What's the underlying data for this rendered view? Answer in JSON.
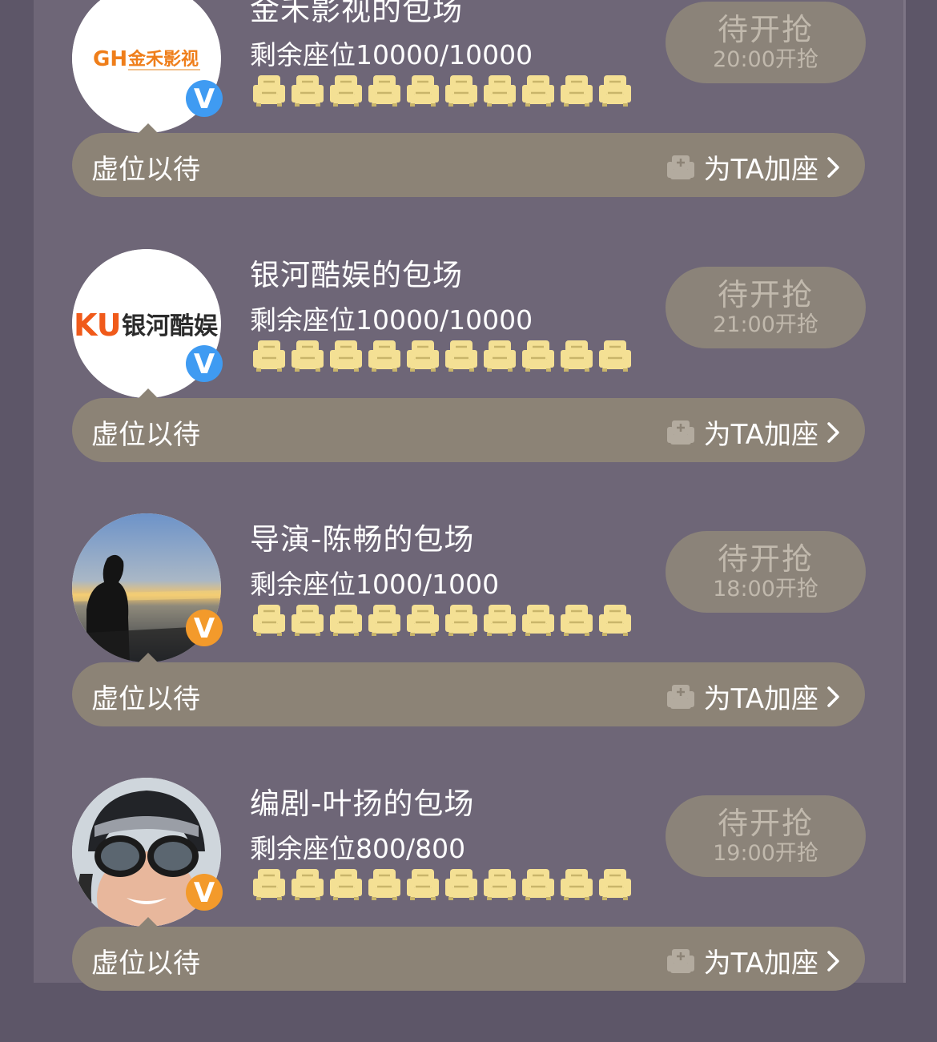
{
  "colors": {
    "background": "#5d5668",
    "panel": "#6e6677",
    "pill": "#8b8379",
    "bar": "#8c8376",
    "seat_gold": "#f4e094",
    "verify_blue": "#3f9bf2",
    "verify_orange": "#f39a2b"
  },
  "cards": [
    {
      "avatar_logo_text": "金禾影视",
      "badge": "V",
      "title": "金禾影视的包场",
      "seats_text": "剩余座位10000/10000",
      "button_main": "待开抢",
      "button_time": "20:00开抢",
      "bar_left": "虚位以待",
      "bar_action": "为TA加座"
    },
    {
      "avatar_logo_text": "银河酷娱",
      "badge": "V",
      "title": "银河酷娱的包场",
      "seats_text": "剩余座位10000/10000",
      "button_main": "待开抢",
      "button_time": "21:00开抢",
      "bar_left": "虚位以待",
      "bar_action": "为TA加座"
    },
    {
      "badge": "V",
      "title": "导演-陈畅的包场",
      "seats_text": "剩余座位1000/1000",
      "button_main": "待开抢",
      "button_time": "18:00开抢",
      "bar_left": "虚位以待",
      "bar_action": "为TA加座"
    },
    {
      "badge": "V",
      "title": "编剧-叶扬的包场",
      "seats_text": "剩余座位800/800",
      "button_main": "待开抢",
      "button_time": "19:00开抢",
      "bar_left": "虚位以待",
      "bar_action": "为TA加座"
    }
  ],
  "icons": {
    "seat": "armchair-icon",
    "add_seat": "add-seat-icon",
    "chevron": "chevron-right-icon",
    "verified": "verified-v-badge"
  }
}
